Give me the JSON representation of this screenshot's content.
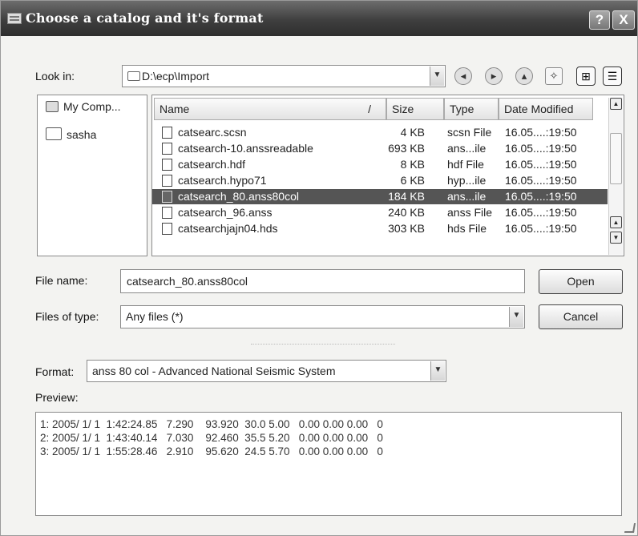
{
  "window": {
    "title": "Choose a catalog and it's format",
    "help_button": "?",
    "close_button": "X"
  },
  "look_in": {
    "label": "Look in:",
    "value": "D:\\ecp\\Import"
  },
  "places": [
    {
      "label": "My Comp...",
      "icon": "computer-icon"
    },
    {
      "label": "sasha",
      "icon": "folder-icon"
    }
  ],
  "file_list": {
    "columns": [
      "Name",
      "Size",
      "Type",
      "Date Modified"
    ],
    "sort_indicator": "/",
    "rows": [
      {
        "name": "catsearc.scsn",
        "size": "4 KB",
        "type": "scsn File",
        "date": "16.05....:19:50",
        "selected": false
      },
      {
        "name": "catsearch-10.anssreadable",
        "size": "693 KB",
        "type": "ans...ile",
        "date": "16.05....:19:50",
        "selected": false
      },
      {
        "name": "catsearch.hdf",
        "size": "8 KB",
        "type": "hdf File",
        "date": "16.05....:19:50",
        "selected": false
      },
      {
        "name": "catsearch.hypo71",
        "size": "6 KB",
        "type": "hyp...ile",
        "date": "16.05....:19:50",
        "selected": false
      },
      {
        "name": "catsearch_80.anss80col",
        "size": "184 KB",
        "type": "ans...ile",
        "date": "16.05....:19:50",
        "selected": true
      },
      {
        "name": "catsearch_96.anss",
        "size": "240 KB",
        "type": "anss File",
        "date": "16.05....:19:50",
        "selected": false
      },
      {
        "name": "catsearchjajn04.hds",
        "size": "303 KB",
        "type": "hds File",
        "date": "16.05....:19:50",
        "selected": false
      }
    ]
  },
  "file_name": {
    "label": "File name:",
    "value": "catsearch_80.anss80col"
  },
  "files_of_type": {
    "label": "Files of type:",
    "value": "Any files (*)"
  },
  "buttons": {
    "open": "Open",
    "cancel": "Cancel"
  },
  "format": {
    "label": "Format:",
    "value": "anss 80 col - Advanced National Seismic System"
  },
  "preview": {
    "label": "Preview:",
    "lines": [
      "1: 2005/ 1/ 1  1:42:24.85   7.290    93.920  30.0 5.00   0.00 0.00 0.00   0",
      "2: 2005/ 1/ 1  1:43:40.14   7.030    92.460  35.5 5.20   0.00 0.00 0.00   0",
      "3: 2005/ 1/ 1  1:55:28.46   2.910    95.620  24.5 5.70   0.00 0.00 0.00   0"
    ]
  }
}
